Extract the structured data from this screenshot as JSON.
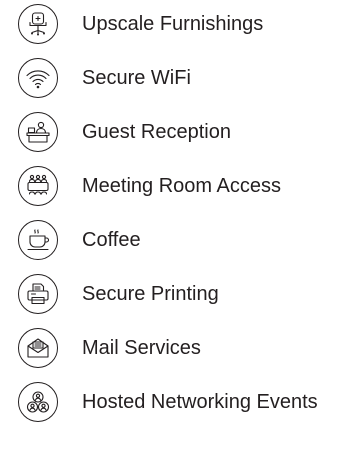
{
  "amenities": [
    {
      "label": "Upscale Furnishings",
      "icon": "office-chair-icon"
    },
    {
      "label": "Secure WiFi",
      "icon": "wifi-icon"
    },
    {
      "label": "Guest Reception",
      "icon": "reception-desk-icon"
    },
    {
      "label": "Meeting Room Access",
      "icon": "meeting-table-icon"
    },
    {
      "label": "Coffee",
      "icon": "coffee-cup-icon"
    },
    {
      "label": "Secure Printing",
      "icon": "printer-icon"
    },
    {
      "label": "Mail Services",
      "icon": "envelope-icon"
    },
    {
      "label": "Hosted Networking Events",
      "icon": "people-group-icon"
    }
  ],
  "colors": {
    "text": "#231f20",
    "icon_stroke": "#231f20",
    "background": "#ffffff"
  }
}
